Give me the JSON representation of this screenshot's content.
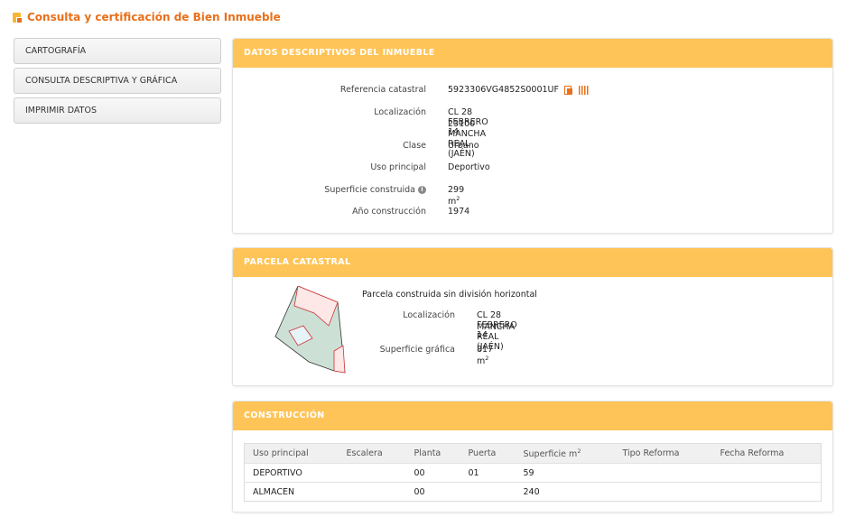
{
  "page": {
    "title": "Consulta y certificación de Bien Inmueble"
  },
  "sidebar": {
    "items": [
      {
        "label": "CARTOGRAFÍA"
      },
      {
        "label": "CONSULTA DESCRIPTIVA Y GRÁFICA"
      },
      {
        "label": "IMPRIMIR DATOS"
      }
    ]
  },
  "datos": {
    "header": "DATOS DESCRIPTIVOS DEL INMUEBLE",
    "referencia_label": "Referencia catastral",
    "referencia_value": "5923306VG4852S0001UF",
    "localizacion_label": "Localización",
    "localizacion_line1": "CL 28 FEBRERO 14",
    "localizacion_line2": "23100 MANCHA REAL (JAÉN)",
    "clase_label": "Clase",
    "clase_value": "Urbano",
    "uso_label": "Uso principal",
    "uso_value": "Deportivo",
    "superficie_label": "Superficie construida",
    "superficie_value": "299 m",
    "superficie_unit_sup": "2",
    "anio_label": "Año construcción",
    "anio_value": "1974"
  },
  "parcela": {
    "header": "PARCELA CATASTRAL",
    "descripcion": "Parcela construida sin división horizontal",
    "localizacion_label": "Localización",
    "localizacion_line1": "CL 28 FEBRERO 14",
    "localizacion_line2": "MANCHA REAL (JAÉN)",
    "superficie_label": "Superficie gráfica",
    "superficie_value": "817 m",
    "superficie_unit_sup": "2"
  },
  "construccion": {
    "header": "CONSTRUCCIÓN",
    "columns": [
      "Uso principal",
      "Escalera",
      "Planta",
      "Puerta",
      "Superficie m",
      "Tipo Reforma",
      "Fecha Reforma"
    ],
    "superficie_col_sup": "2",
    "rows": [
      [
        "DEPORTIVO",
        "",
        "00",
        "01",
        "59",
        "",
        ""
      ],
      [
        "ALMACEN",
        "",
        "00",
        "",
        "240",
        "",
        ""
      ]
    ]
  },
  "icons": {
    "title": "document-icon",
    "copy": "copy-icon",
    "barcode": "barcode-icon",
    "info": "info-icon"
  },
  "colors": {
    "accent": "#e8701a",
    "header_bg": "#fec457"
  }
}
